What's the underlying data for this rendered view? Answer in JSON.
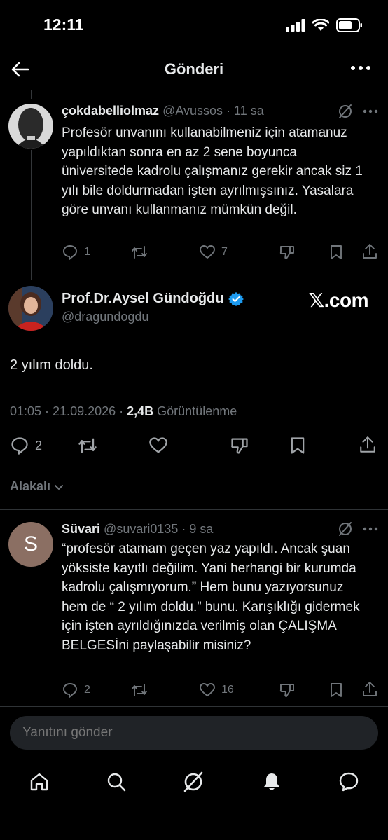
{
  "status_bar": {
    "time": "12:11"
  },
  "header": {
    "title": "Gönderi"
  },
  "parent_tweet": {
    "name": "çokdabelliolmaz",
    "handle": "@Avussos",
    "time": "· 11 sa",
    "text": "Profesör unvanını kullanabilmeniz için atamanuz yapıldıktan sonra en az 2 sene boyunca üniversitede kadrolu çalışmanız gerekir ancak siz 1 yılı bile doldurmadan işten ayrılmışsınız. Yasalara göre unvanı kullanmanız mümkün değil.",
    "replies": "1",
    "likes": "7"
  },
  "main_tweet": {
    "name": "Prof.Dr.Aysel Gündoğdu",
    "handle": "@dragundogdu",
    "watermark": "𝕏.com",
    "text": "2 yılım doldu.",
    "timestamp": "01:05 · 21.09.2026 · ",
    "views_count": "2,4B",
    "views_label": " Görüntülenme",
    "replies": "2"
  },
  "related_label": "Alakalı",
  "reply_tweet": {
    "avatar_letter": "S",
    "name": "Süvari",
    "handle": "@suvari0135",
    "time": "· 9 sa",
    "text": "“profesör atamam geçen yaz yapıldı. Ancak şuan yöksiste kayıtlı değilim. Yani herhangi bir kurumda kadrolu çalışmıyorum.” Hem bunu yazıyorsunuz hem de “ 2 yılım doldu.” bunu. Karışıklığı gidermek için işten ayrıldığınızda verilmiş olan ÇALIŞMA BELGESİni paylaşabilir misiniz?",
    "replies": "2",
    "likes": "16"
  },
  "reply_bar": {
    "placeholder": "Yanıtını gönder"
  },
  "colors": {
    "background": "#000000",
    "muted": "#71767b",
    "verified": "#1d9bf0"
  }
}
